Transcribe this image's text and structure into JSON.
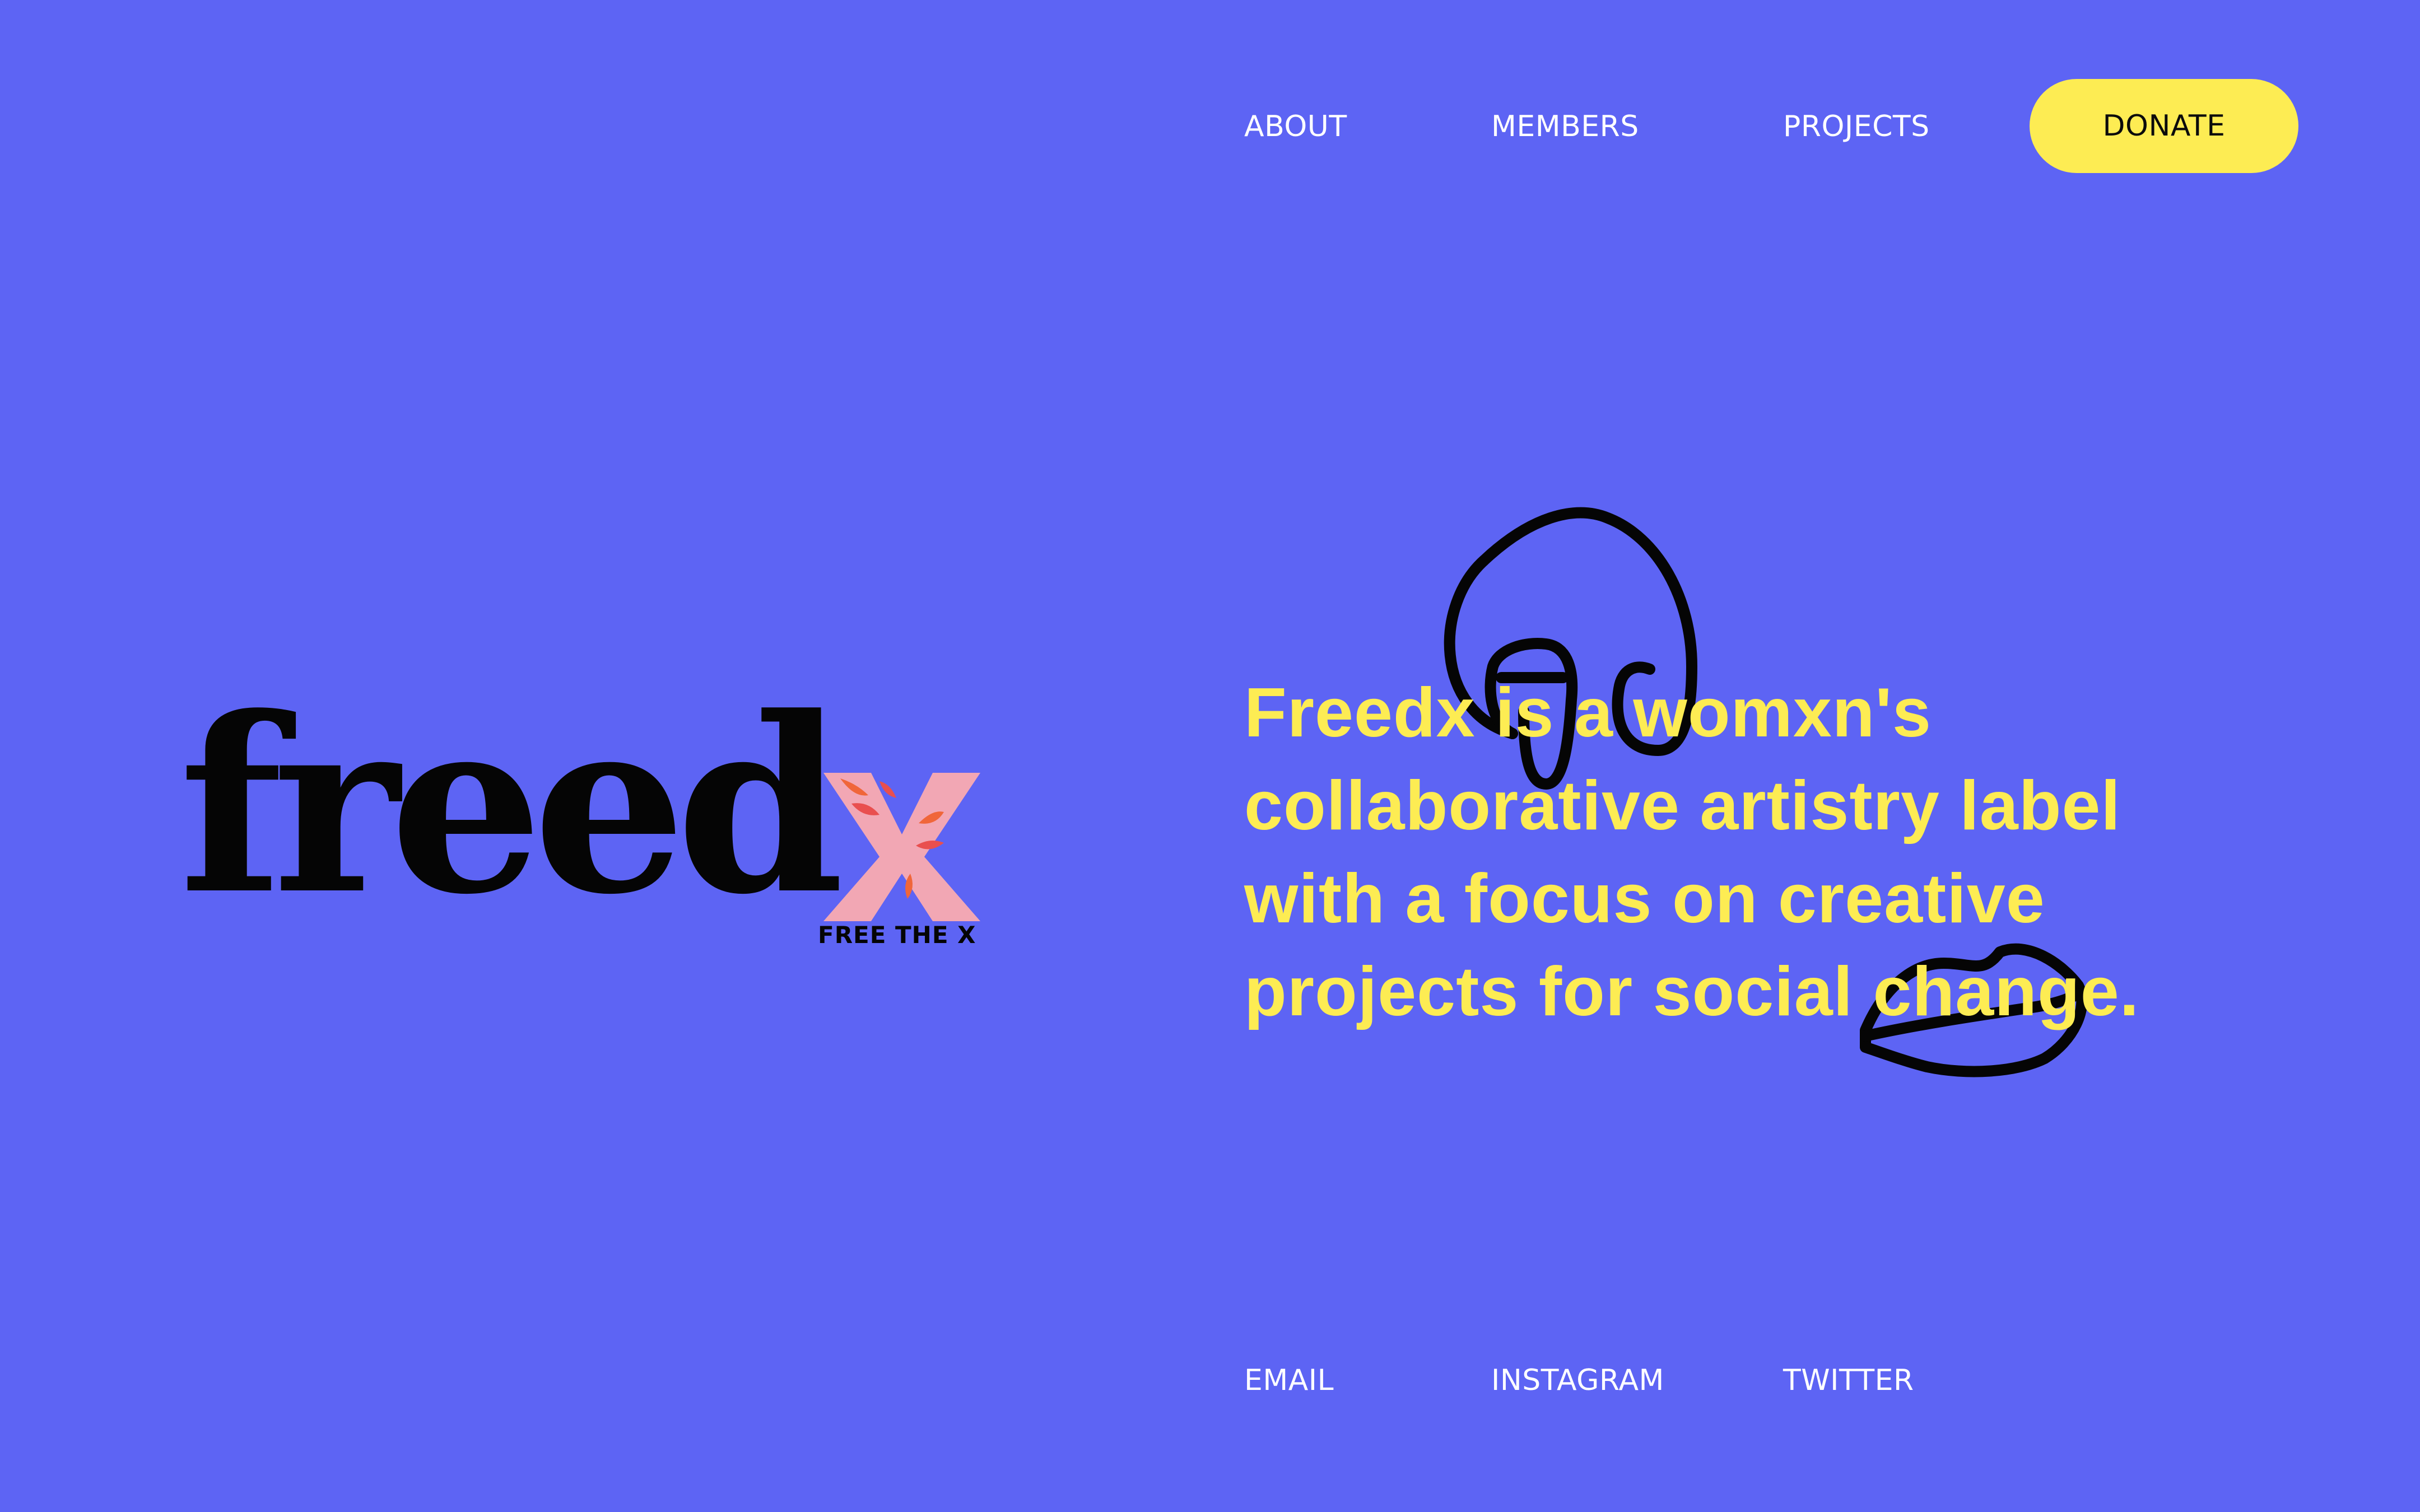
{
  "colors": {
    "background": "#5d64f4",
    "accent_yellow": "#fdec53",
    "logo_black": "#050505",
    "x_pink": "#f2a7b4",
    "x_orange": "#f0663a"
  },
  "nav": {
    "about": "ABOUT",
    "members": "MEMBERS",
    "projects": "PROJECTS",
    "donate": "DONATE"
  },
  "logo": {
    "wordmark": "freed",
    "letter_x": "X",
    "tagline": "FREE THE X"
  },
  "hero": {
    "headline": "Freedx is a womxn's collaborative artistry label with a focus on creative projects for social change."
  },
  "footer": {
    "email": "EMAIL",
    "instagram": "INSTAGRAM",
    "twitter": "TWITTER"
  },
  "icons": {
    "face_doodle": "face-line-drawing-icon",
    "lips_doodle": "lips-line-drawing-icon"
  }
}
